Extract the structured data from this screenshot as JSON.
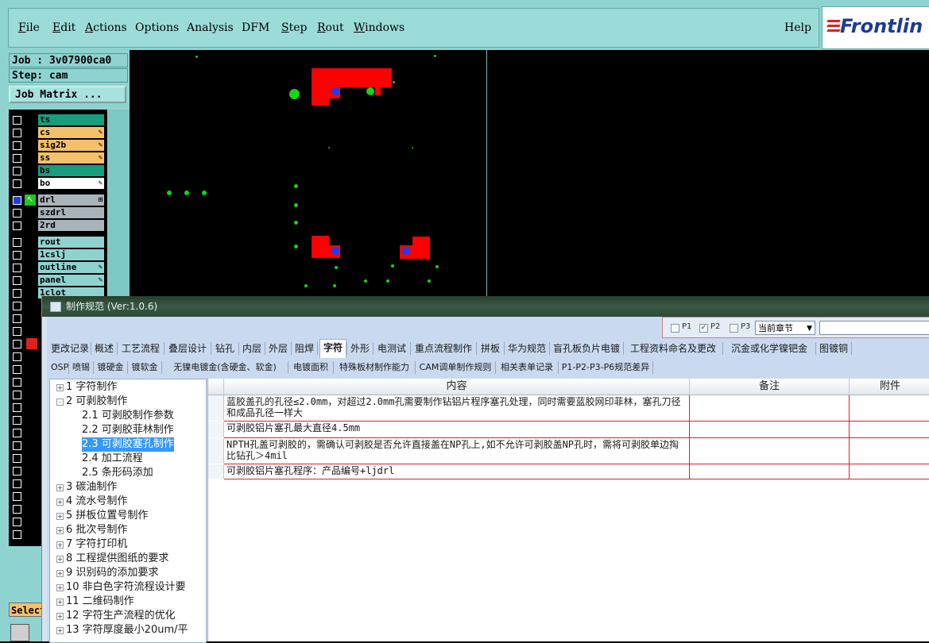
{
  "menu": {
    "items": [
      "File",
      "Edit",
      "Actions",
      "Options",
      "Analysis",
      "DFM",
      "Step",
      "Rout",
      "Windows"
    ],
    "help": "Help",
    "logo": "Frontlin"
  },
  "sidebar": {
    "job": "Job : 3v07900ca0",
    "step": "Step: cam",
    "job_matrix": "Job Matrix ...",
    "select": "Select"
  },
  "layers": [
    {
      "name": "ts",
      "color": "#169e7d",
      "flag": ""
    },
    {
      "name": "cs",
      "color": "#f5c06a",
      "flag": "✎"
    },
    {
      "name": "sig2b",
      "color": "#f5c06a",
      "flag": "✎"
    },
    {
      "name": "ss",
      "color": "#f5c06a",
      "flag": "✎"
    },
    {
      "name": "bs",
      "color": "#169e7d",
      "flag": ""
    },
    {
      "name": "bo",
      "color": "#ffffff",
      "flag": "✎"
    },
    {
      "name": "drl",
      "color": "#a9b3ba",
      "flag": "⊞"
    },
    {
      "name": "szdrl",
      "color": "#a9b3ba",
      "flag": ""
    },
    {
      "name": "2rd",
      "color": "#a9b3ba",
      "flag": ""
    },
    {
      "name": "rout",
      "color": "#8fd3d1",
      "flag": ""
    },
    {
      "name": "1cslj",
      "color": "#8fd3d1",
      "flag": ""
    },
    {
      "name": "outline",
      "color": "#8fd3d1",
      "flag": "✎"
    },
    {
      "name": "panel",
      "color": "#8fd3d1",
      "flag": "✎"
    },
    {
      "name": "1clot",
      "color": "#8fd3d1",
      "flag": ""
    }
  ],
  "spec_window": {
    "title": "制作规范 (Ver:1.0.6)",
    "filter": {
      "p1": "P1",
      "p2": "P2",
      "p3": "P3",
      "p1_checked": false,
      "p2_checked": true,
      "p3_checked": false,
      "chapter": "当前章节"
    },
    "tabs_row1": [
      "更改记录",
      "概述",
      "工艺流程",
      "叠层设计",
      "钻孔",
      "内层",
      "外层",
      "阻焊",
      "字符",
      "外形",
      "电测试",
      "重点流程制作",
      "拼板",
      "华为规范",
      "盲孔板负片电镀",
      "工程资料命名及更改",
      "沉金或化学镍钯金",
      "图镀铜"
    ],
    "active_tab": "字符",
    "tabs_row2": [
      "OSP",
      "喷锡",
      "镀硬金",
      "镀软金",
      "无镍电镀金(含硬金、软金)",
      "电镀面积",
      "特殊板材制作能力",
      "CAM调单制作规则",
      "相关表单记录",
      "P1-P2-P3-P6规范差异"
    ],
    "tree": [
      {
        "label": "1  字符制作",
        "level": 0,
        "exp": "+"
      },
      {
        "label": "2  可剥胶制作",
        "level": 0,
        "exp": "-"
      },
      {
        "label": "2.1  可剥胶制作参数",
        "level": 1,
        "exp": ""
      },
      {
        "label": "2.2  可剥胶菲林制作",
        "level": 1,
        "exp": ""
      },
      {
        "label": "2.3  可剥胶塞孔制作",
        "level": 1,
        "exp": "",
        "selected": true
      },
      {
        "label": "2.4  加工流程",
        "level": 1,
        "exp": ""
      },
      {
        "label": "2.5  条形码添加",
        "level": 1,
        "exp": ""
      },
      {
        "label": "3  碳油制作",
        "level": 0,
        "exp": "+"
      },
      {
        "label": "4  流水号制作",
        "level": 0,
        "exp": "+"
      },
      {
        "label": "5  拼板位置号制作",
        "level": 0,
        "exp": "+"
      },
      {
        "label": "6  批次号制作",
        "level": 0,
        "exp": "+"
      },
      {
        "label": "7  字符打印机",
        "level": 0,
        "exp": "+"
      },
      {
        "label": "8  工程提供图纸的要求",
        "level": 0,
        "exp": "+"
      },
      {
        "label": "9  识别码的添加要求",
        "level": 0,
        "exp": "+"
      },
      {
        "label": "10  非白色字符流程设计要",
        "level": 0,
        "exp": "+"
      },
      {
        "label": "11  二维码制作",
        "level": 0,
        "exp": "+"
      },
      {
        "label": "12  字符生产流程的优化",
        "level": 0,
        "exp": "+"
      },
      {
        "label": "13  字符厚度最小20um/平",
        "level": 0,
        "exp": "+"
      }
    ],
    "table": {
      "headers": [
        "内容",
        "备注",
        "附件"
      ],
      "rows": [
        {
          "content": "蓝胶盖孔的孔径≤2.0mm，对超过2.0mm孔需要制作钻铝片程序塞孔处理，同时需要蓝胶网印菲林，塞孔刀径和成品孔径一样大",
          "note": "",
          "attachment": ""
        },
        {
          "content": "可剥胶铝片塞孔最大直径4.5mm",
          "note": "",
          "attachment": ""
        },
        {
          "content": "NPTH孔盖可剥胶的，需确认可剥胶是否允许直接盖在NP孔上,如不允许可剥胶盖NP孔时，需将可剥胶单边掏比钻孔＞4mil",
          "note": "",
          "attachment": ""
        },
        {
          "content": "可剥胶铝片塞孔程序：产品编号+ljdrl",
          "note": "",
          "attachment": ""
        }
      ]
    }
  }
}
